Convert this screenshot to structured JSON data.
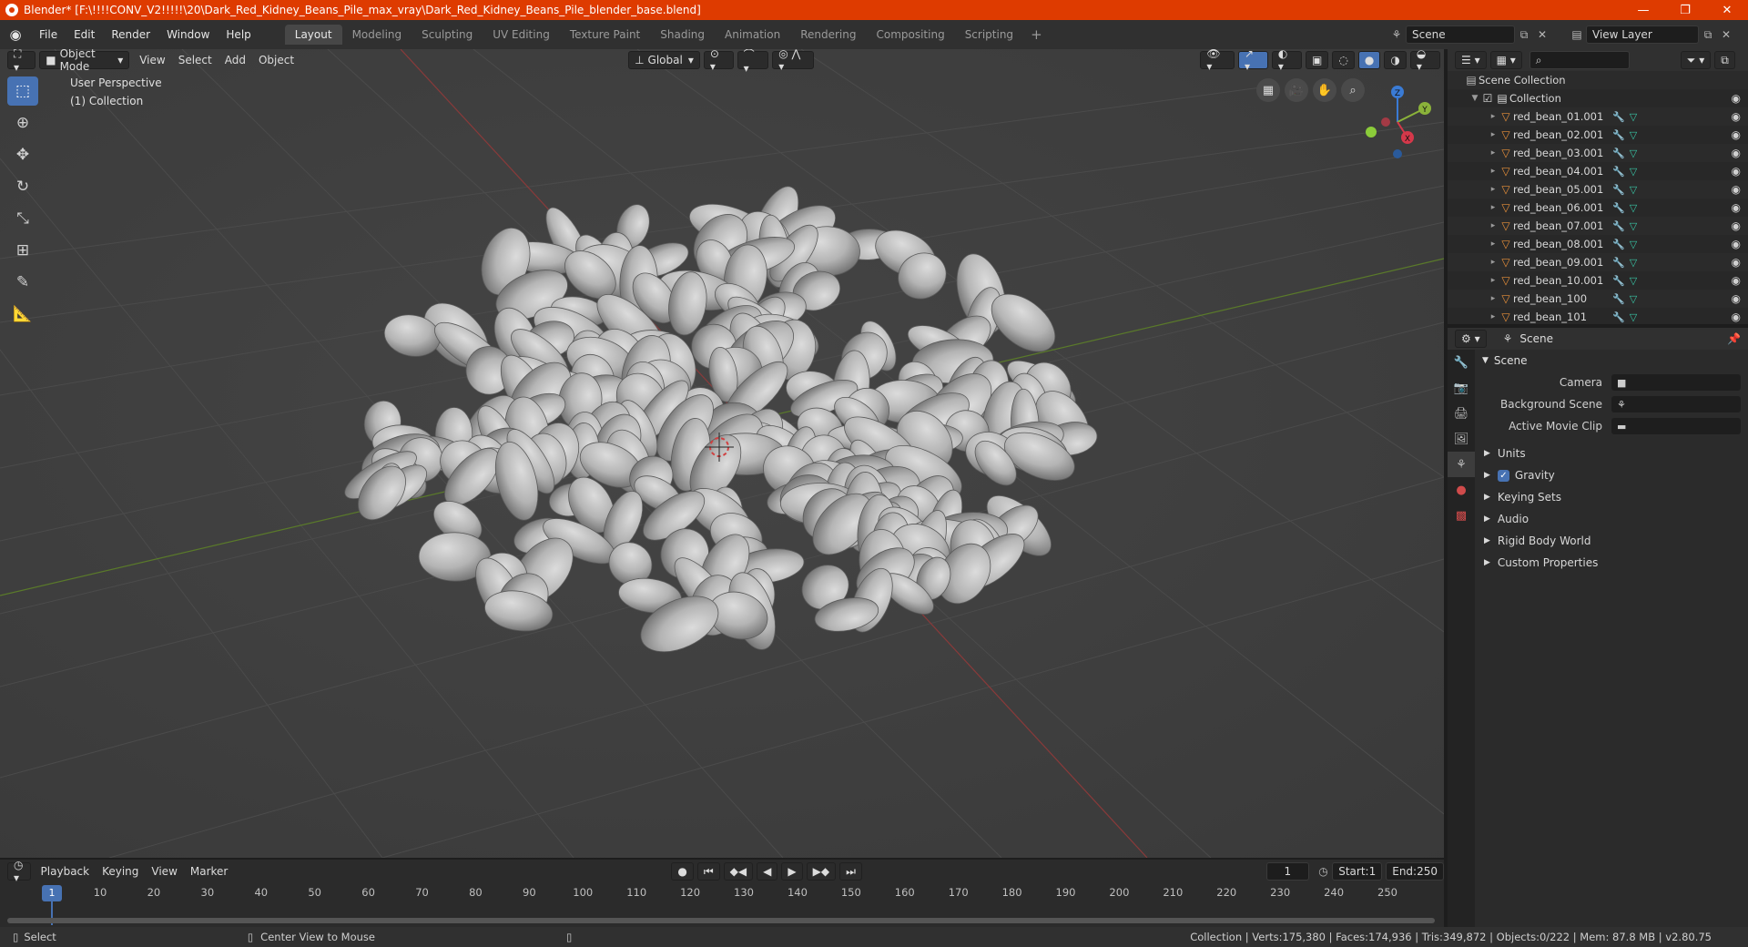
{
  "window": {
    "title": "Blender* [F:\\!!!!CONV_V2!!!!!\\20\\Dark_Red_Kidney_Beans_Pile_max_vray\\Dark_Red_Kidney_Beans_Pile_blender_base.blend]",
    "minimize": "—",
    "maximize": "❐",
    "close": "✕"
  },
  "menu": [
    "File",
    "Edit",
    "Render",
    "Window",
    "Help"
  ],
  "workspaces": [
    "Layout",
    "Modeling",
    "Sculpting",
    "UV Editing",
    "Texture Paint",
    "Shading",
    "Animation",
    "Rendering",
    "Compositing",
    "Scripting"
  ],
  "workspace_add": "+",
  "scene_name": "Scene",
  "view_layer_name": "View Layer",
  "viewport": {
    "mode": "Object Mode",
    "menus": [
      "View",
      "Select",
      "Add",
      "Object"
    ],
    "orientation": "Global",
    "perspective_label": "User Perspective",
    "collection_label": "(1) Collection",
    "gizmo_axes": {
      "x": "X",
      "y": "Y",
      "z": "Z"
    }
  },
  "outliner": {
    "root": "Scene Collection",
    "collection": "Collection",
    "items": [
      "red_bean_01.001",
      "red_bean_02.001",
      "red_bean_03.001",
      "red_bean_04.001",
      "red_bean_05.001",
      "red_bean_06.001",
      "red_bean_07.001",
      "red_bean_08.001",
      "red_bean_09.001",
      "red_bean_10.001",
      "red_bean_100",
      "red_bean_101"
    ]
  },
  "properties": {
    "context": "Scene",
    "panel": "Scene",
    "camera_label": "Camera",
    "background_label": "Background Scene",
    "movieclip_label": "Active Movie Clip",
    "sections": [
      "Units",
      "Gravity",
      "Keying Sets",
      "Audio",
      "Rigid Body World",
      "Custom Properties"
    ]
  },
  "timeline": {
    "menus": [
      "Playback",
      "Keying",
      "View",
      "Marker"
    ],
    "current_frame": "1",
    "start_label": "Start:",
    "start": "1",
    "end_label": "End:",
    "end": "250",
    "ticks": [
      "1",
      "10",
      "20",
      "30",
      "40",
      "50",
      "60",
      "70",
      "80",
      "90",
      "100",
      "110",
      "120",
      "130",
      "140",
      "150",
      "160",
      "170",
      "180",
      "190",
      "200",
      "210",
      "220",
      "230",
      "240",
      "250"
    ]
  },
  "status": {
    "left": "Select",
    "middle": "Center View to Mouse",
    "right": "Collection | Verts:175,380 | Faces:174,936 | Tris:349,872 | Objects:0/222 | Mem: 87.8 MB | v2.80.75"
  }
}
